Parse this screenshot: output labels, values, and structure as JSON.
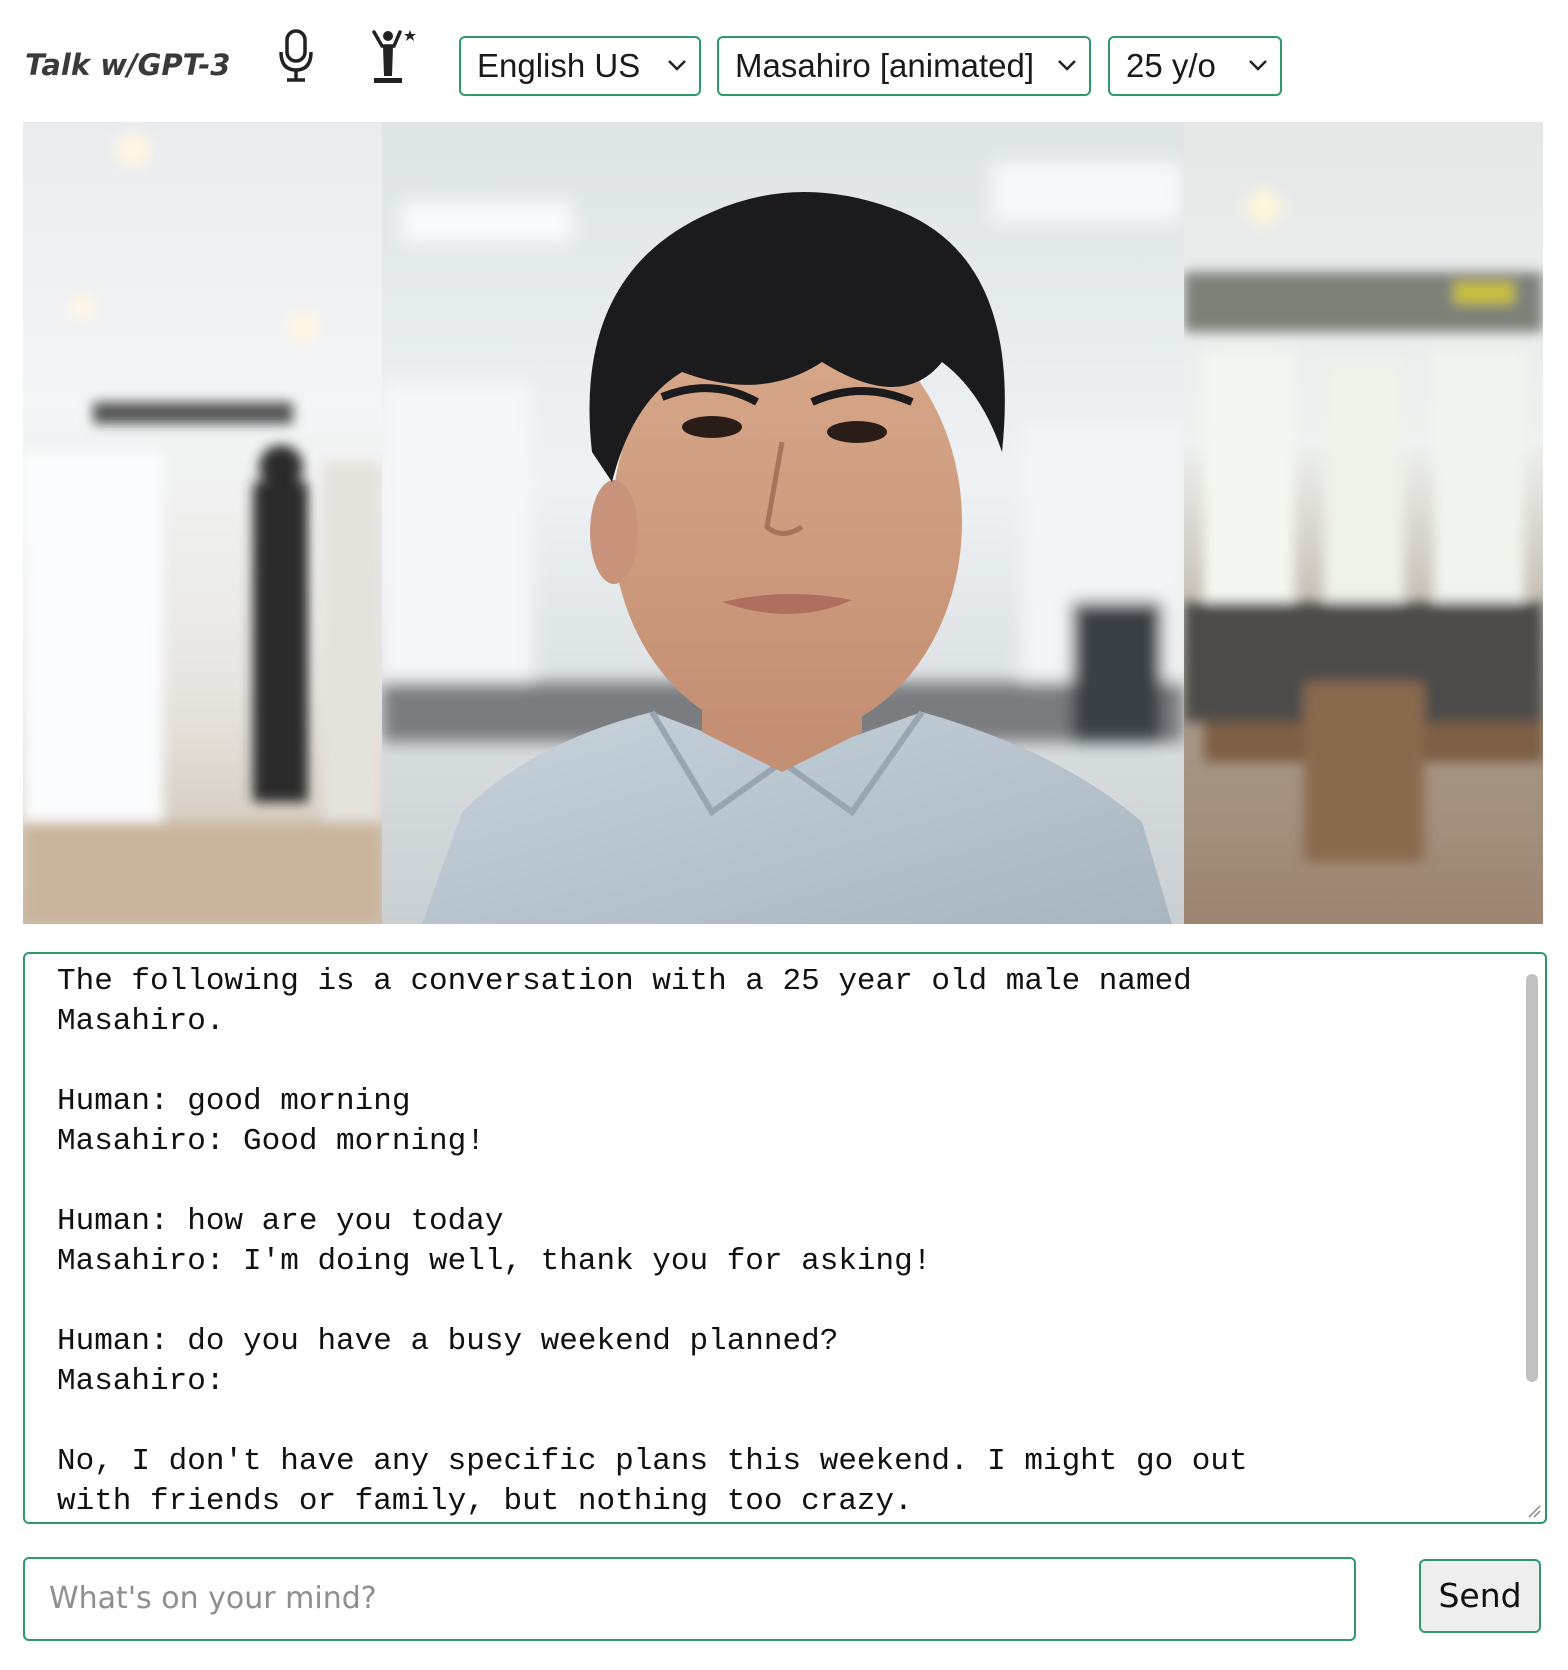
{
  "header": {
    "app_title": "Talk w/GPT-3",
    "icons": [
      "microphone-icon",
      "animated-avatar-icon"
    ],
    "language_select": {
      "value": "English US"
    },
    "character_select": {
      "value": "Masahiro [animated]"
    },
    "age_select": {
      "value": "25 y/o"
    }
  },
  "colors": {
    "accent": "#2e9a6b",
    "button_bg": "#efefef",
    "placeholder": "#8f8f8f"
  },
  "transcript": {
    "text": "The following is a conversation with a 25 year old male named\nMasahiro.\n\nHuman: good morning\nMasahiro: Good morning!\n\nHuman: how are you today\nMasahiro: I'm doing well, thank you for asking!\n\nHuman: do you have a busy weekend planned?\nMasahiro:\n\nNo, I don't have any specific plans this weekend. I might go out\nwith friends or family, but nothing too crazy."
  },
  "composer": {
    "placeholder": "What's on your mind?",
    "value": "",
    "send_label": "Send"
  }
}
